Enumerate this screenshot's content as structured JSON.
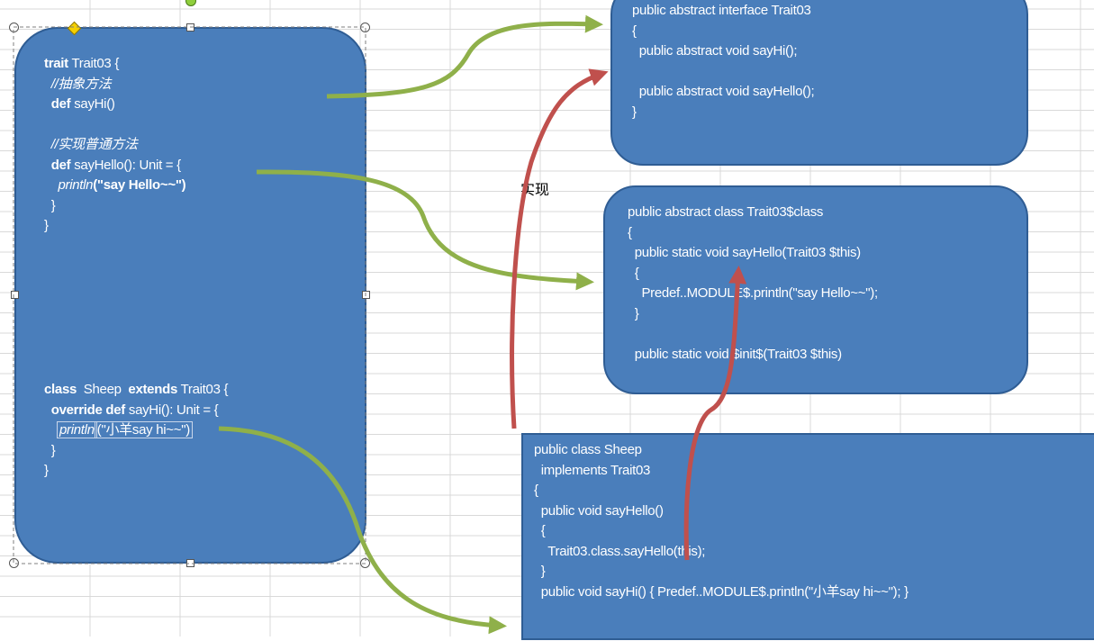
{
  "left_box": {
    "lines": [
      {
        "parts": [
          {
            "t": "trait",
            "kw": true
          },
          {
            "t": " Trait03 {"
          }
        ]
      },
      {
        "parts": [
          {
            "t": "  //抽象方法",
            "it": true
          }
        ]
      },
      {
        "parts": [
          {
            "t": "  def",
            "kw": true
          },
          {
            "t": " sayHi()"
          }
        ]
      },
      {
        "parts": [
          {
            "t": ""
          }
        ]
      },
      {
        "parts": [
          {
            "t": "  //实现普通方法",
            "it": true
          }
        ]
      },
      {
        "parts": [
          {
            "t": "  def",
            "kw": true
          },
          {
            "t": " sayHello(): Unit = {"
          }
        ]
      },
      {
        "parts": [
          {
            "t": "    println",
            "it": true
          },
          {
            "t": "(\"say Hello~~\")",
            "kw": true
          }
        ]
      },
      {
        "parts": [
          {
            "t": "  }"
          }
        ]
      },
      {
        "parts": [
          {
            "t": "}"
          }
        ]
      }
    ],
    "lines2": [
      {
        "parts": [
          {
            "t": "class",
            "kw": true
          },
          {
            "t": "  Sheep  "
          },
          {
            "t": "extends",
            "kw": true
          },
          {
            "t": " Trait03 {"
          }
        ]
      },
      {
        "parts": [
          {
            "t": "  override def",
            "kw": true
          },
          {
            "t": " sayHi(): Unit = {"
          }
        ]
      },
      {
        "parts": [
          {
            "t": "println",
            "it": true,
            "boxed": true
          },
          {
            "t": "(\"小羊say hi~~\")",
            "boxed": true
          }
        ],
        "indent": true
      },
      {
        "parts": [
          {
            "t": "  }"
          }
        ]
      },
      {
        "parts": [
          {
            "t": "}"
          }
        ]
      }
    ]
  },
  "box_interface": {
    "lines": [
      "public abstract interface Trait03",
      "{",
      "  public abstract void sayHi();",
      "",
      "  public abstract void sayHello();",
      "}"
    ]
  },
  "box_class": {
    "lines": [
      "public abstract class Trait03$class",
      "{",
      "  public static void sayHello(Trait03 $this)",
      "  {",
      "    Predef..MODULE$.println(\"say Hello~~\");",
      "  }",
      "",
      "  public static void $init$(Trait03 $this)"
    ]
  },
  "box_sheep": {
    "lines": [
      "public class Sheep",
      "  implements Trait03",
      "{",
      "  public void sayHello()",
      "  {",
      "    Trait03.class.sayHello(this);",
      "  }",
      "  public void sayHi() { Predef..MODULE$.println(\"小羊say hi~~\"); }"
    ]
  },
  "label_implements": "实现",
  "colors": {
    "box_fill": "#4a7ebb",
    "green_arrow": "#8fb04a",
    "red_arrow": "#c0504d",
    "grid": "#d9d9d9"
  }
}
